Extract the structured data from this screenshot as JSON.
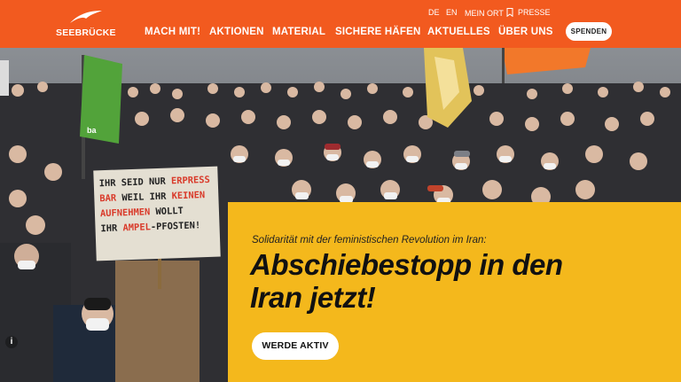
{
  "header": {
    "logo_text": "SEEBRÜCKE",
    "nav": [
      "MACH MIT!",
      "AKTIONEN",
      "MATERIAL",
      "SICHERE HÄFEN",
      "AKTUELLES",
      "ÜBER UNS"
    ],
    "utility": {
      "lang_de": "DE",
      "lang_en": "EN",
      "mein_ort": "MEIN ORT",
      "presse": "PRESSE"
    },
    "spenden_label": "SPENDEN"
  },
  "hero": {
    "sign_lines": [
      {
        "black": "IHR SEID NUR ",
        "red": "ERPRESS"
      },
      {
        "red": "BAR",
        "black": " WEIL IHR ",
        "red2": "KEINEN"
      },
      {
        "red": "AUFNEHMEN",
        "black": " WOLLT"
      },
      {
        "black": "IHR ",
        "red": "AMPEL",
        "black2": "-PFOSTEN!"
      }
    ],
    "flag_text": "ba"
  },
  "panel": {
    "kicker": "Solidarität mit der feministischen Revolution im Iran:",
    "headline_line1": "Abschiebestopp in den",
    "headline_line2": "Iran jetzt!",
    "cta_label": "WERDE AKTIV"
  },
  "colors": {
    "header_bg": "#f25a1f",
    "panel_bg": "#f4b81c",
    "sign_red": "#d93a2a"
  }
}
